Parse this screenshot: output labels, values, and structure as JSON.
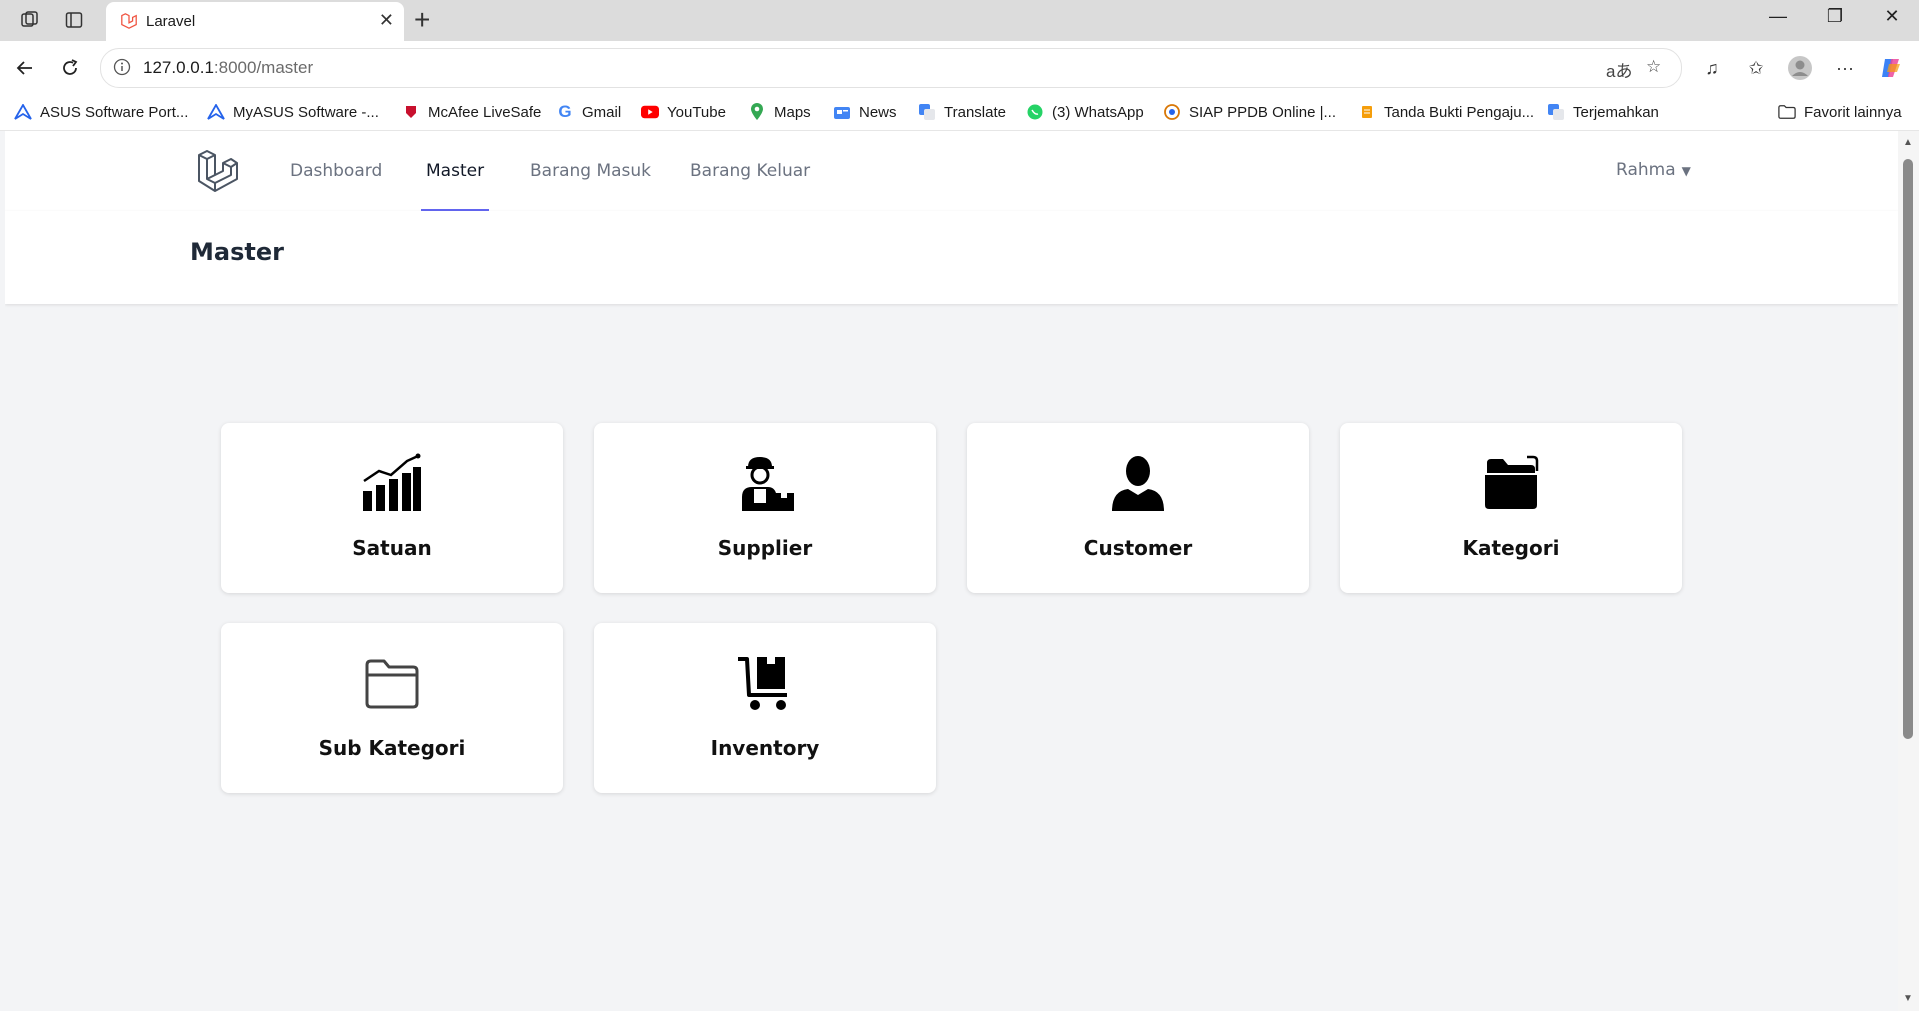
{
  "browser": {
    "tab_title": "Laravel",
    "url_host": "127.0.0.1",
    "url_rest": ":8000/master",
    "bookmarks": [
      "ASUS Software Port...",
      "MyASUS Software -...",
      "McAfee LiveSafe",
      "Gmail",
      "YouTube",
      "Maps",
      "News",
      "Translate",
      "(3) WhatsApp",
      "SIAP PPDB Online |...",
      "Tanda Bukti Pengaju...",
      "Terjemahkan"
    ],
    "other_favorites": "Favorit lainnya"
  },
  "app": {
    "nav": {
      "items": [
        "Dashboard",
        "Master",
        "Barang Masuk",
        "Barang Keluar"
      ],
      "active": "Master"
    },
    "user": {
      "name": "Rahma"
    },
    "page_title": "Master",
    "cards": [
      {
        "label": "Satuan",
        "icon": "bar-chart-trend-icon"
      },
      {
        "label": "Supplier",
        "icon": "delivery-person-icon"
      },
      {
        "label": "Customer",
        "icon": "person-icon"
      },
      {
        "label": "Kategori",
        "icon": "folder-filled-icon"
      },
      {
        "label": "Sub Kategori",
        "icon": "folder-outline-icon"
      },
      {
        "label": "Inventory",
        "icon": "shopping-cart-icon"
      }
    ]
  },
  "colors": {
    "accent": "#6366f1",
    "page_bg": "#f3f4f6",
    "card_bg": "#ffffff"
  }
}
